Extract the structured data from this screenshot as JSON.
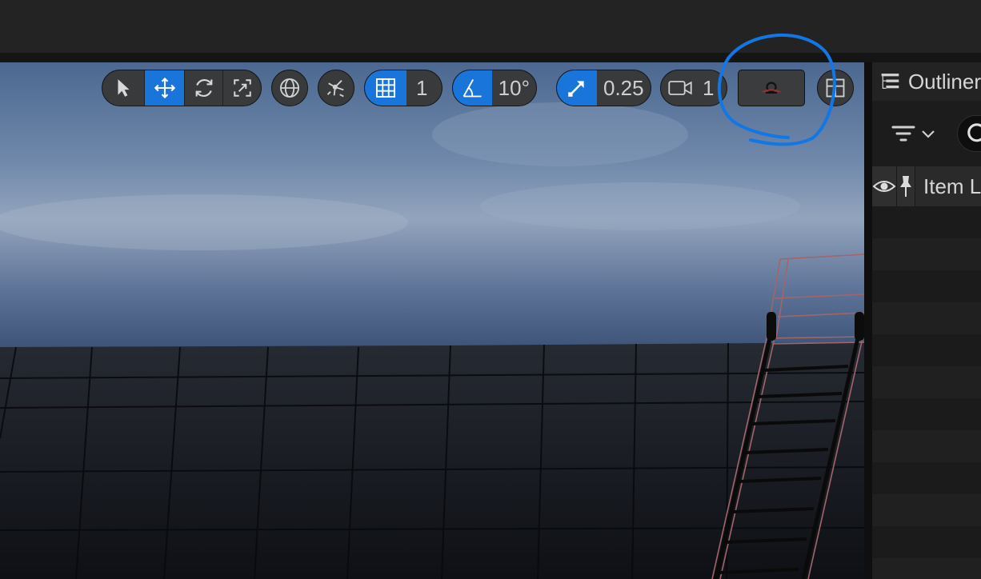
{
  "toolbar": {
    "grid_snap_value": "1",
    "rotation_snap_value": "10°",
    "scale_snap_value": "0.25",
    "camera_speed_value": "1"
  },
  "outliner": {
    "title": "Outliner",
    "column_item_label": "Item Label",
    "row_count": 11
  },
  "colors": {
    "accent": "#1a75db",
    "annotation": "#1177e6",
    "toolbar_bg": "#383a3c",
    "panel_bg": "#1c1c1c"
  }
}
